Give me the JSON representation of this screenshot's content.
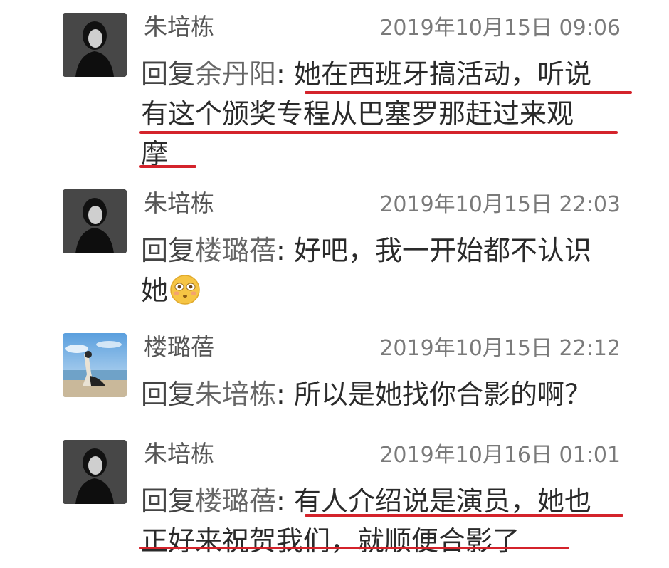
{
  "comments": [
    {
      "author": "朱培栋",
      "time": "2019年10月15日 09:06",
      "reply_prefix": "回复",
      "reply_to": "余丹阳",
      "separator": ":",
      "lines": [
        "她在西班牙搞活动，听说",
        "有这个颁奖专程从巴塞罗那赶过来观",
        "摩"
      ],
      "avatar": "dark-portrait-avatar"
    },
    {
      "author": "朱培栋",
      "time": "2019年10月15日 22:03",
      "reply_prefix": "回复",
      "reply_to": "楼璐蓓",
      "separator": ":",
      "lines": [
        "好吧，我一开始都不认识",
        "她"
      ],
      "emoji": "embarrassed-face-emoji",
      "avatar": "dark-portrait-avatar"
    },
    {
      "author": "楼璐蓓",
      "time": "2019年10月15日 22:12",
      "reply_prefix": "回复",
      "reply_to": "朱培栋",
      "separator": ":",
      "lines": [
        "所以是她找你合影的啊？"
      ],
      "avatar": "beach-photo-avatar"
    },
    {
      "author": "朱培栋",
      "time": "2019年10月16日 01:01",
      "reply_prefix": "回复",
      "reply_to": "楼璐蓓",
      "separator": ":",
      "lines": [
        "有人介绍说是演员，她也",
        "正好来祝贺我们，就顺便合影了"
      ],
      "avatar": "dark-portrait-avatar"
    }
  ],
  "colors": {
    "underline": "#d4232b",
    "name": "#555555",
    "time": "#7a7a7a",
    "text": "#2a2a2a"
  }
}
